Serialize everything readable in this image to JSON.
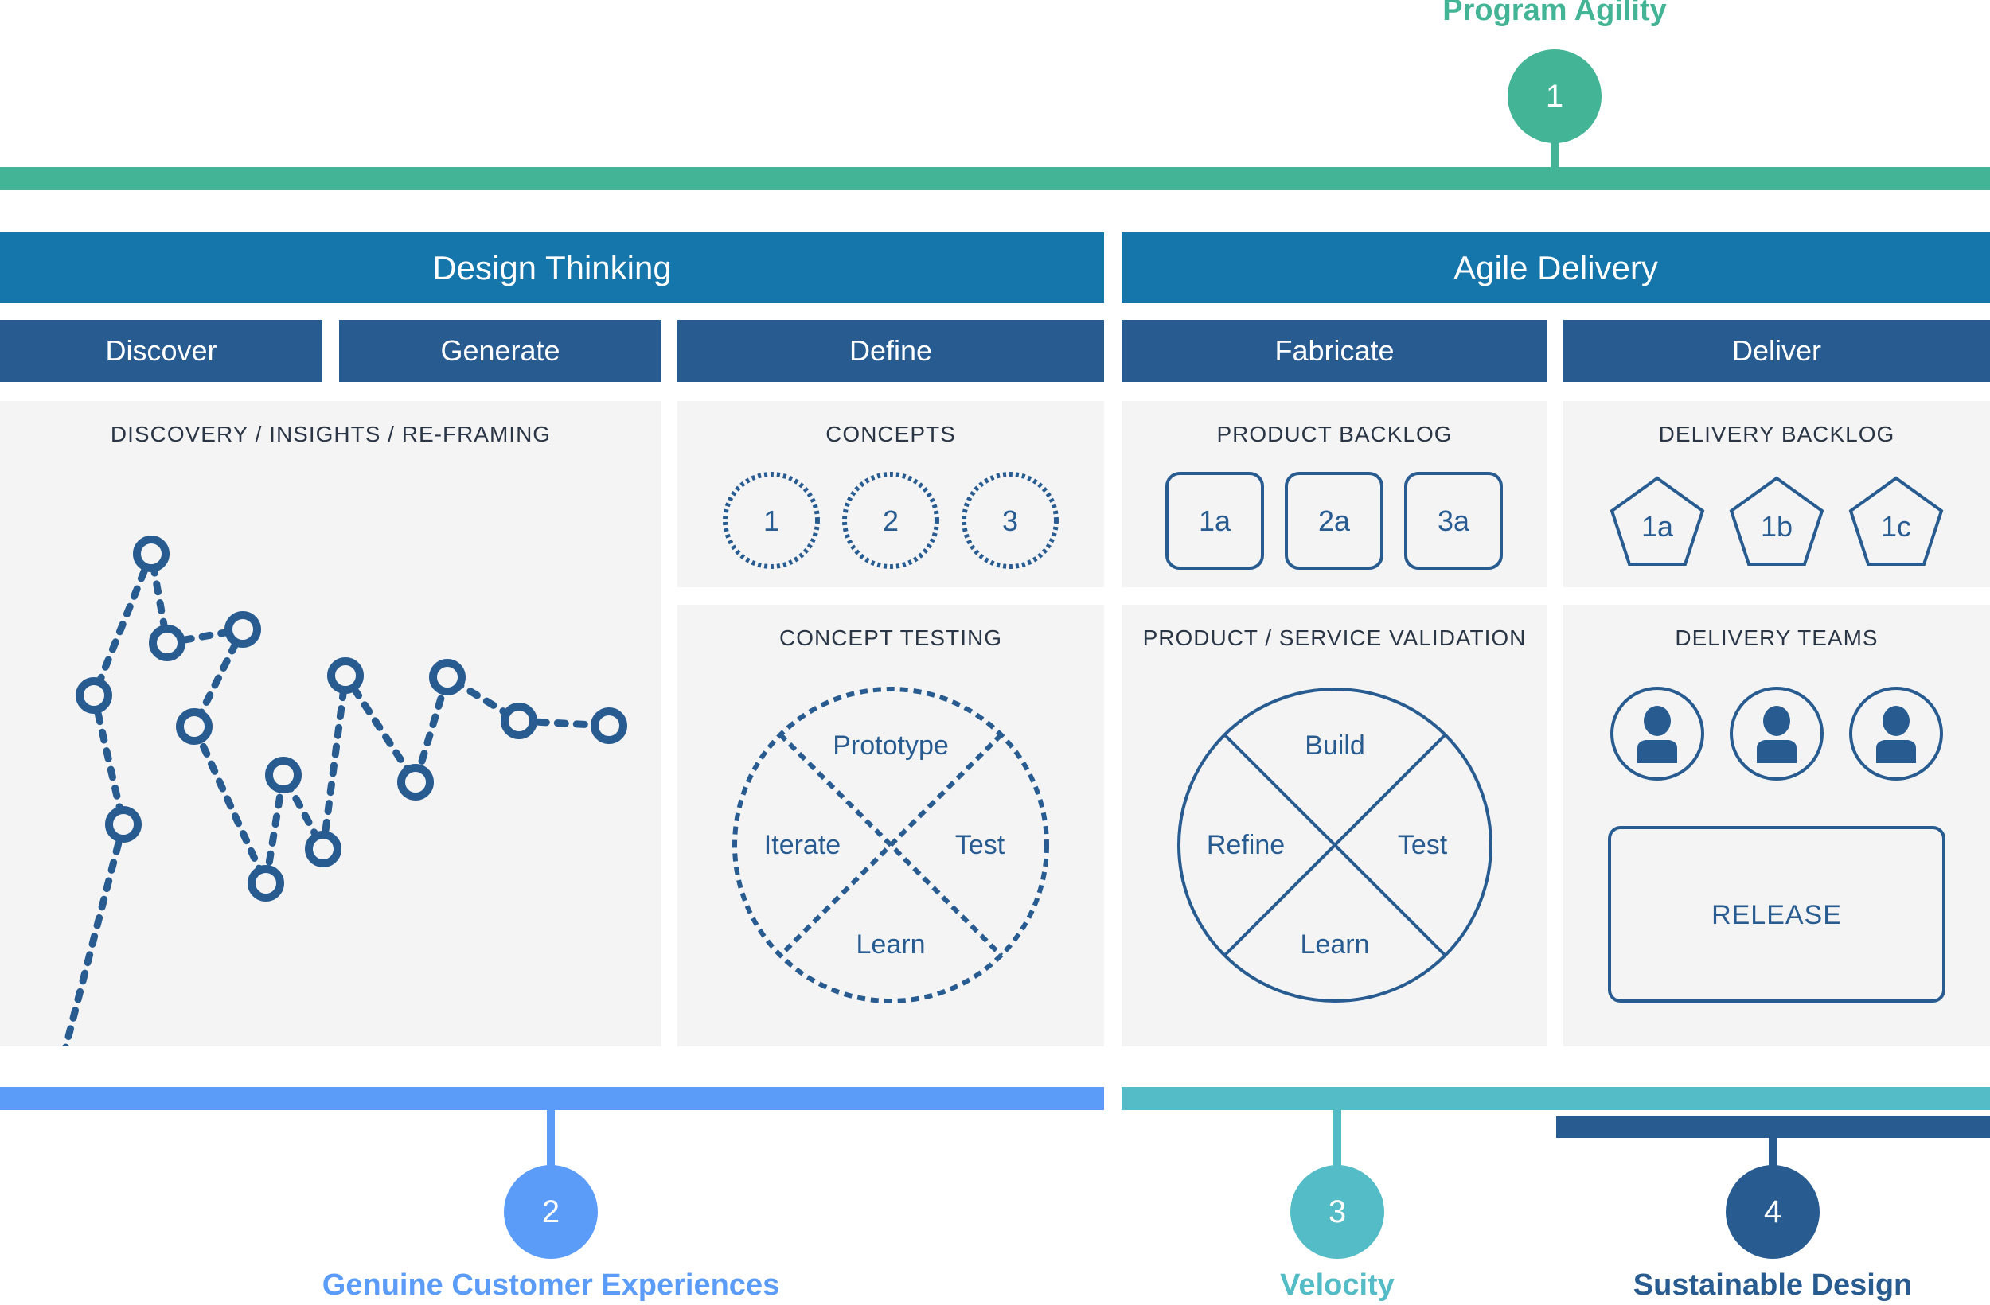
{
  "colors": {
    "green": "#44b496",
    "header_blue": "#1576ac",
    "sub_blue": "#285c91",
    "light_blue": "#5b9cf8",
    "teal": "#53bcc6",
    "dark_blue": "#285c91",
    "panel_bg": "#f4f4f4",
    "title_text": "#2a3646",
    "shape_stroke": "#285c91"
  },
  "markers": [
    {
      "number": "1",
      "label": "Program Agility"
    },
    {
      "number": "2",
      "label": "Genuine Customer Experiences"
    },
    {
      "number": "3",
      "label": "Velocity"
    },
    {
      "number": "4",
      "label": "Sustainable Design"
    }
  ],
  "headers": {
    "design_thinking": "Design Thinking",
    "agile_delivery": "Agile Delivery"
  },
  "phases": [
    "Discover",
    "Generate",
    "Define",
    "Fabricate",
    "Deliver"
  ],
  "panels": {
    "discovery": {
      "title": "DISCOVERY / INSIGHTS / RE-FRAMING"
    },
    "concepts": {
      "title": "CONCEPTS",
      "items": [
        "1",
        "2",
        "3"
      ]
    },
    "concept_testing": {
      "title": "CONCEPT TESTING",
      "quadrants": {
        "top": "Prototype",
        "left": "Iterate",
        "right": "Test",
        "bottom": "Learn"
      }
    },
    "product_backlog": {
      "title": "PRODUCT BACKLOG",
      "items": [
        "1a",
        "2a",
        "3a"
      ]
    },
    "product_validation": {
      "title": "PRODUCT / SERVICE VALIDATION",
      "quadrants": {
        "top": "Build",
        "left": "Refine",
        "right": "Test",
        "bottom": "Learn"
      }
    },
    "delivery_backlog": {
      "title": "DELIVERY BACKLOG",
      "items": [
        "1a",
        "1b",
        "1c"
      ]
    },
    "delivery_teams": {
      "title": "DELIVERY TEAMS",
      "team_count": 3,
      "release_label": "RELEASE"
    }
  }
}
